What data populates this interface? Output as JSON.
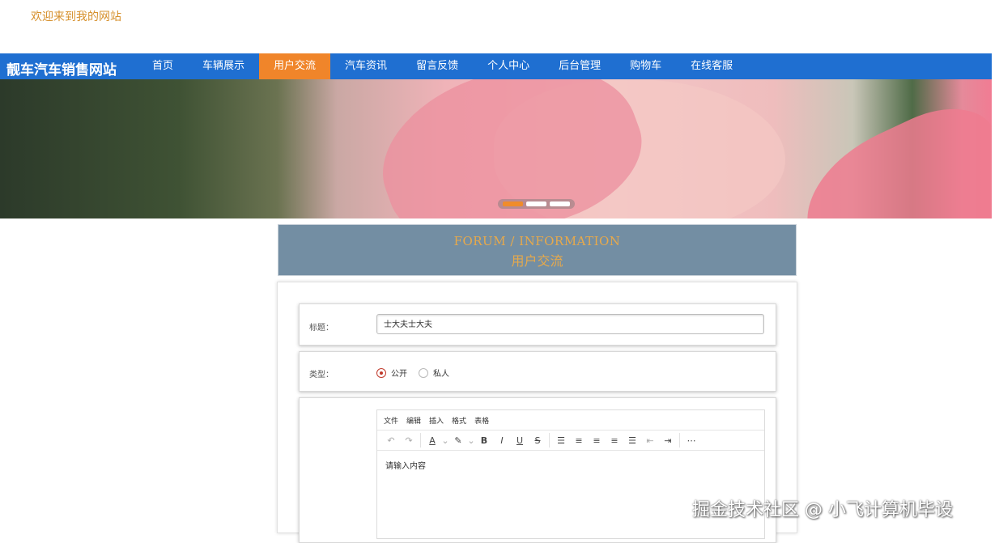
{
  "header": {
    "welcome_text": "欢迎来到我的网站"
  },
  "nav": {
    "brand": "靓车汽车销售网站",
    "items": [
      {
        "label": "首页"
      },
      {
        "label": "车辆展示"
      },
      {
        "label": "用户交流"
      },
      {
        "label": "汽车资讯"
      },
      {
        "label": "留言反馈"
      },
      {
        "label": "个人中心"
      },
      {
        "label": "后台管理"
      },
      {
        "label": "购物车"
      },
      {
        "label": "在线客服"
      }
    ],
    "active_label": "用户交流",
    "colors": {
      "bar": "#1f6fd1",
      "active": "#f0852a"
    }
  },
  "banner": {
    "slides_count": 3,
    "active_slide": 1
  },
  "section": {
    "title_en": "FORUM / INFORMATION",
    "title_cn": "用户交流"
  },
  "form": {
    "title_label": "标题：",
    "title_value": "士大夫士大夫",
    "type_label": "类型：",
    "type_options": [
      {
        "label": "公开",
        "checked": true
      },
      {
        "label": "私人",
        "checked": false
      }
    ],
    "editor": {
      "menus": [
        "文件",
        "编辑",
        "插入",
        "格式",
        "表格"
      ],
      "toolbar_icons": [
        "undo-icon",
        "redo-icon",
        "text-color-icon",
        "highlight-color-icon",
        "bold-icon",
        "italic-icon",
        "underline-icon",
        "strikethrough-icon",
        "list-icon",
        "align-left-icon",
        "align-center-icon",
        "align-right-icon",
        "align-justify-icon",
        "outdent-icon",
        "indent-icon",
        "more-icon"
      ],
      "placeholder": "请输入内容"
    }
  },
  "watermark": "掘金技术社区 @ 小飞计算机毕设"
}
